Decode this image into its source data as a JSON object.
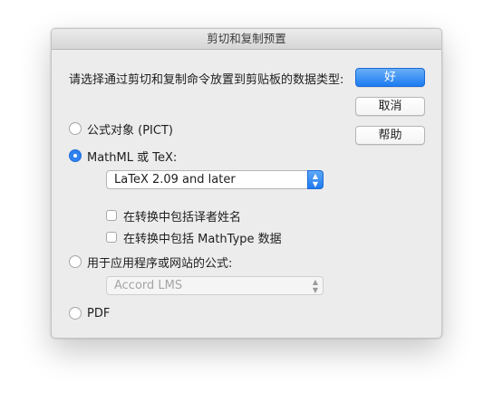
{
  "window": {
    "title": "剪切和复制预置"
  },
  "prompt": "请选择通过剪切和复制命令放置到剪贴板的数据类型:",
  "buttons": {
    "ok": "好",
    "cancel": "取消",
    "help": "帮助"
  },
  "options": {
    "pict": {
      "label": "公式对象 (PICT)",
      "selected": false
    },
    "mathml": {
      "label": "MathML 或 TeX:",
      "selected": true,
      "select_value": "LaTeX 2.09 and later",
      "check_translator": {
        "label": "在转换中包括译者姓名",
        "checked": false
      },
      "check_mathtype": {
        "label": "在转换中包括 MathType 数据",
        "checked": false
      }
    },
    "app": {
      "label": "用于应用程序或网站的公式:",
      "selected": false,
      "select_value": "Accord LMS",
      "select_disabled": true
    },
    "pdf": {
      "label": "PDF",
      "selected": false
    }
  },
  "colors": {
    "accent": "#1b7cf0",
    "dialog_bg": "#ececec"
  },
  "icons": {
    "select_arrows": "chevron-up-down-icon"
  }
}
